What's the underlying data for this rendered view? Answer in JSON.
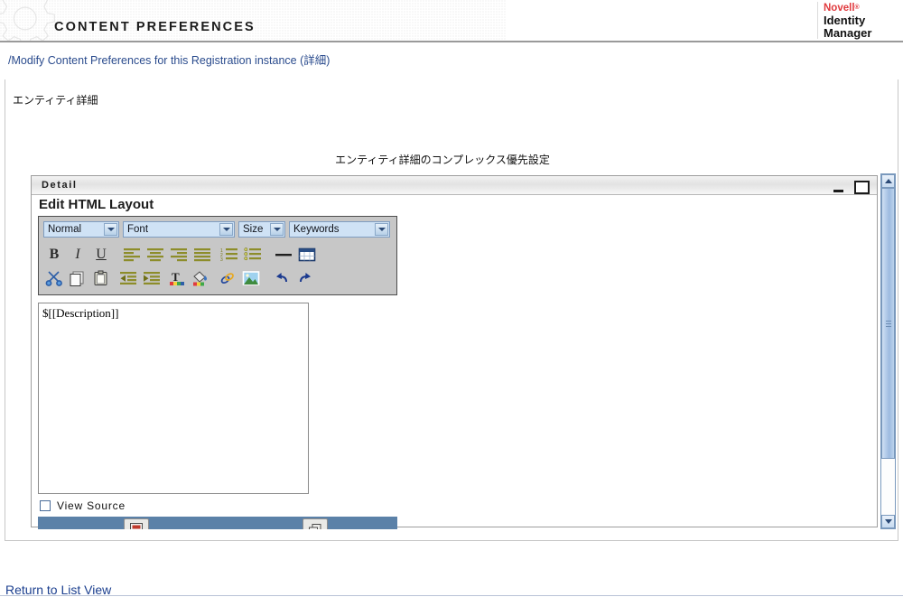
{
  "header": {
    "title": "CONTENT PREFERENCES",
    "gear_icon": "gear-watermark-icon",
    "brand": {
      "name": "Novell",
      "registered": "®",
      "product_line1": "Identity",
      "product_line2": "Manager"
    }
  },
  "breadcrumb": {
    "text": "/Modify Content Preferences for this Registration instance (詳細)"
  },
  "content": {
    "section_label": "エンティティ詳細",
    "complex_title": "エンティティ詳細のコンプレックス優先設定"
  },
  "detail_panel": {
    "title": "Detail",
    "heading": "Edit HTML Layout",
    "minimize_label": "minimize",
    "maximize_label": "maximize"
  },
  "editor": {
    "selects": [
      {
        "name": "style",
        "value": "Normal"
      },
      {
        "name": "font",
        "value": "Font"
      },
      {
        "name": "size",
        "value": "Size"
      },
      {
        "name": "keywords",
        "value": "Keywords"
      }
    ],
    "toolbar_row1": [
      {
        "id": "bold",
        "label": "B",
        "icon": "bold-icon"
      },
      {
        "id": "italic",
        "label": "I",
        "icon": "italic-icon"
      },
      {
        "id": "underline",
        "label": "U",
        "icon": "underline-icon"
      },
      {
        "id": "align-left",
        "label": "",
        "icon": "align-left-icon"
      },
      {
        "id": "align-center",
        "label": "",
        "icon": "align-center-icon"
      },
      {
        "id": "align-right",
        "label": "",
        "icon": "align-right-icon"
      },
      {
        "id": "align-justify",
        "label": "",
        "icon": "align-justify-icon"
      },
      {
        "id": "ordered-list",
        "label": "",
        "icon": "ordered-list-icon"
      },
      {
        "id": "unordered-list",
        "label": "",
        "icon": "unordered-list-icon"
      },
      {
        "id": "horizontal-rule",
        "label": "",
        "icon": "horizontal-rule-icon"
      },
      {
        "id": "insert-table",
        "label": "",
        "icon": "table-icon"
      }
    ],
    "toolbar_row2": [
      {
        "id": "cut",
        "label": "",
        "icon": "scissors-icon"
      },
      {
        "id": "copy",
        "label": "",
        "icon": "copy-icon"
      },
      {
        "id": "paste",
        "label": "",
        "icon": "clipboard-icon"
      },
      {
        "id": "outdent",
        "label": "",
        "icon": "outdent-icon"
      },
      {
        "id": "indent",
        "label": "",
        "icon": "indent-icon"
      },
      {
        "id": "text-color",
        "label": "",
        "icon": "text-color-icon"
      },
      {
        "id": "background-color",
        "label": "",
        "icon": "paint-bucket-icon"
      },
      {
        "id": "insert-link",
        "label": "",
        "icon": "link-icon"
      },
      {
        "id": "insert-image",
        "label": "",
        "icon": "image-icon"
      },
      {
        "id": "undo",
        "label": "",
        "icon": "undo-icon"
      },
      {
        "id": "redo",
        "label": "",
        "icon": "redo-icon"
      }
    ],
    "body_value": "$[[Description]]",
    "view_source_label": "View Source",
    "view_source_checked": false,
    "action_buttons": [
      {
        "id": "save",
        "icon": "save-disk-icon"
      },
      {
        "id": "cancel",
        "icon": "cancel-window-icon"
      }
    ]
  },
  "scrollbar": {
    "up_icon": "scroll-up-arrow-icon",
    "down_icon": "scroll-down-arrow-icon"
  },
  "footer": {
    "return_link": "Return to List View"
  },
  "colors": {
    "brand_red": "#e03a3e",
    "link_blue": "#2a4b8d",
    "footer_link_blue": "#1b3f8f",
    "select_blue": "#cfe2f5",
    "toolbar_gray": "#c7c7c7",
    "action_bar_blue": "#5b81a8",
    "icon_olive": "#8d8d2a"
  }
}
